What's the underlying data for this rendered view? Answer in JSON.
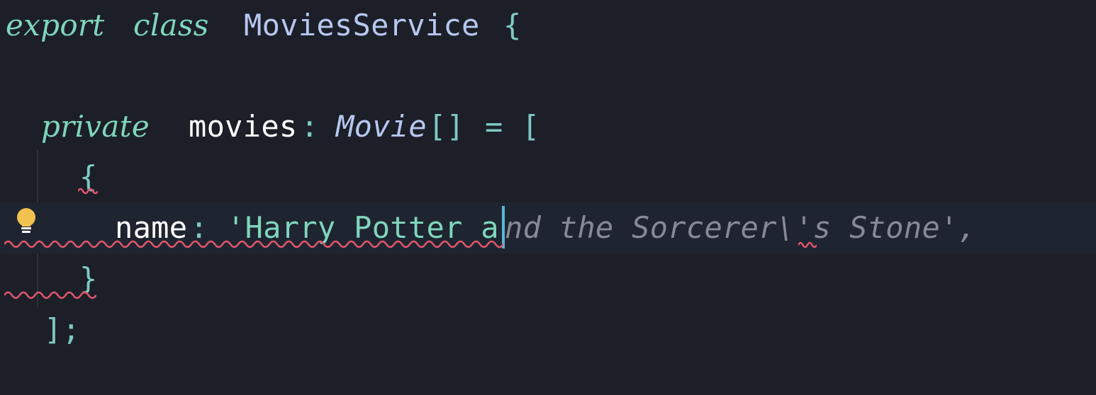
{
  "code": {
    "line1": {
      "kw_export": "export",
      "kw_class": "class",
      "class_name": "MoviesService",
      "brace": "{"
    },
    "line3": {
      "kw_private": "private",
      "prop": "movies",
      "colon": ":",
      "type": "Movie",
      "brackets": "[]",
      "equals": "=",
      "open": "["
    },
    "line4": {
      "brace": "{"
    },
    "line5": {
      "key": "name",
      "colon": ":",
      "typed": "'Harry Potter a",
      "ghost": "nd the Sorcerer\\'s Stone',"
    },
    "line6": {
      "brace": "}"
    },
    "line7": {
      "close": "];"
    }
  },
  "colors": {
    "background": "#1c1f27",
    "keyword": "#7fd6bd",
    "identifier": "#b7c7f0",
    "ghost_text": "#858a94",
    "error_squiggle": "#e0566b",
    "cursor": "#5ab7d8",
    "bulb": "#f2c14e"
  },
  "icons": {
    "gutter": "lightbulb-icon"
  }
}
